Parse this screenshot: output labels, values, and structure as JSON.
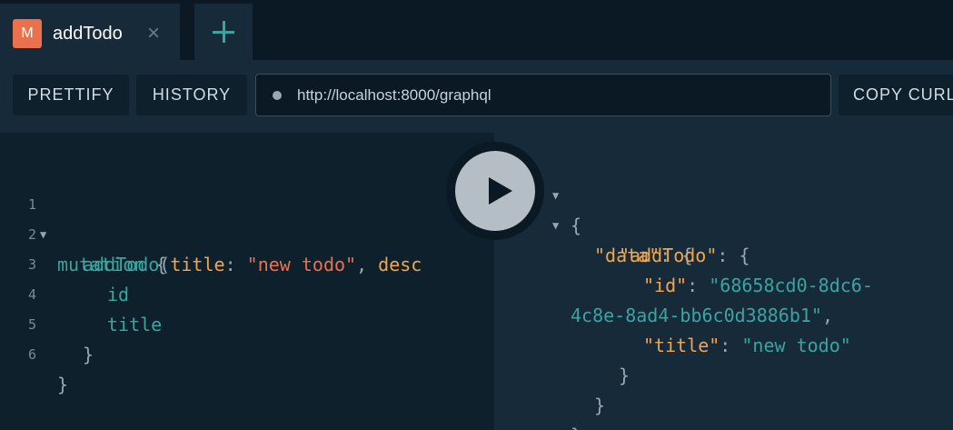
{
  "tab": {
    "badge": "M",
    "title": "addTodo",
    "close_glyph": "×",
    "add_icon": "plus-icon"
  },
  "toolbar": {
    "prettify_label": "PRETTIFY",
    "history_label": "HISTORY",
    "url": "http://localhost:8000/graphql",
    "copy_label": "COPY CURL"
  },
  "query": {
    "line_numbers": [
      "1",
      "2",
      "3",
      "4",
      "5",
      "6"
    ],
    "line1": {
      "keyword": "mutation",
      "brace": "{"
    },
    "line2": {
      "field": "addTodo",
      "open": "(",
      "arg_name": "title",
      "colon": ": ",
      "arg_value": "\"new todo\"",
      "sep": ", ",
      "arg_name2": "desc"
    },
    "line3": {
      "field": "id"
    },
    "line4": {
      "field": "title"
    },
    "line5": {
      "brace": "}"
    },
    "line6": {
      "brace": "}"
    }
  },
  "result": {
    "open_brace": "{",
    "data_key": "\"data\"",
    "addTodo_key": "\"addTodo\"",
    "id_key": "\"id\"",
    "id_value_part1": "\"68658cd0-8dc6-",
    "id_value_part2": "4c8e-8ad4-bb6c0d3886b1\"",
    "title_key": "\"title\"",
    "title_value": "\"new todo\"",
    "colon": ": ",
    "comma": ",",
    "close_brace": "}"
  },
  "colors": {
    "accent_teal": "#3aa4a0",
    "accent_orange": "#e9724c",
    "background": "#172a3a"
  }
}
